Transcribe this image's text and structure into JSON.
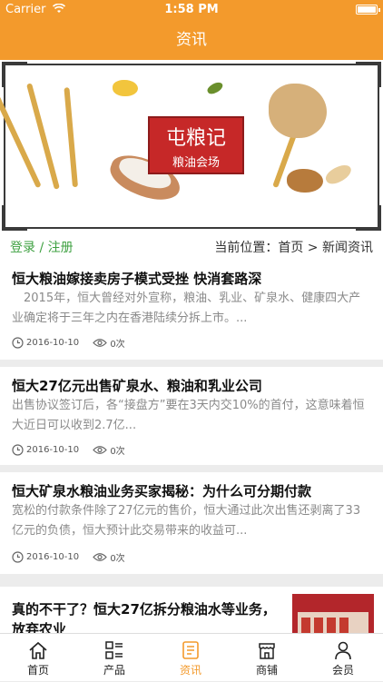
{
  "status": {
    "carrier": "Carrier",
    "time": "1:58 PM"
  },
  "nav": {
    "title": "资讯"
  },
  "banner": {
    "logo_line1": "屯粮记",
    "logo_line2": "粮油会场"
  },
  "subbar": {
    "login": "登录 / 注册",
    "breadcrumb": "当前位置：首页 > 新闻资讯"
  },
  "news": [
    {
      "title": "恒大粮油嫁接卖房子模式受挫 快消套路深",
      "summary": "　2015年，恒大曾经对外宣称，粮油、乳业、矿泉水、健康四大产业确定将于三年之内在香港陆续分拆上市。...",
      "date": "2016-10-10",
      "views": "0次"
    },
    {
      "title": "恒大27亿元出售矿泉水、粮油和乳业公司",
      "summary": "出售协议签订后，各“接盘方”要在3天内交10%的首付，这意味着恒大近日可以收到2.7亿...",
      "date": "2016-10-10",
      "views": "0次"
    },
    {
      "title": "恒大矿泉水粮油业务买家揭秘：为什么可分期付款",
      "summary": "宽松的付款条件除了27亿元的售价，恒大通过此次出售还剥离了33亿元的负债，恒大预计此交易带来的收益可...",
      "date": "2016-10-10",
      "views": "0次"
    },
    {
      "title": "真的不干了？恒大27亿拆分粮油水等业务，放弃农业"
    }
  ],
  "tabs": [
    {
      "label": "首页",
      "icon": "home-icon"
    },
    {
      "label": "产品",
      "icon": "grid-list-icon"
    },
    {
      "label": "资讯",
      "icon": "document-icon"
    },
    {
      "label": "商铺",
      "icon": "store-icon"
    },
    {
      "label": "会员",
      "icon": "user-icon"
    }
  ],
  "colors": {
    "accent": "#f39a2c",
    "login_green": "#3fa142",
    "logo_red": "#c62828"
  }
}
